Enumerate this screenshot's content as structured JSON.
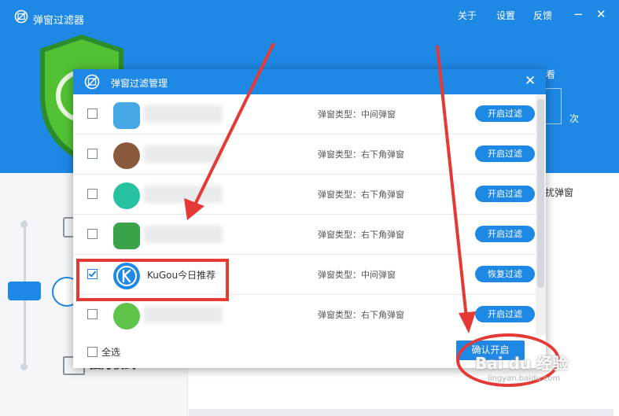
{
  "app": {
    "title": "弹窗过滤器",
    "nav": [
      "关于",
      "设置",
      "反馈"
    ],
    "window_controls": [
      "−",
      "✕"
    ],
    "side_text_1": "看",
    "side_text_2": "次",
    "side_text_3": "扰弹窗",
    "mode_label": "强力模式"
  },
  "dialog": {
    "title": "弹窗过滤管理",
    "close": "✕",
    "rows": [
      {
        "name": "",
        "type": "弹窗类型：中间弹窗",
        "button": "开启过滤",
        "checked": false,
        "thumb_color": "#46a9e6"
      },
      {
        "name": "",
        "type": "弹窗类型：右下角弹窗",
        "button": "开启过滤",
        "checked": false,
        "thumb_color": "#8b5a3c"
      },
      {
        "name": "",
        "type": "弹窗类型：右下角弹窗",
        "button": "开启过滤",
        "checked": false,
        "thumb_color": "#27c2a0"
      },
      {
        "name": "",
        "type": "弹窗类型：右下角弹窗",
        "button": "开启过滤",
        "checked": false,
        "thumb_color": "#3aa34a"
      },
      {
        "name": "KuGou今日推荐",
        "type": "弹窗类型：中间弹窗",
        "button": "恢复过滤",
        "checked": true,
        "thumb_color": "#1e88e5"
      },
      {
        "name": "",
        "type": "弹窗类型：右下角弹窗",
        "button": "开启过滤",
        "checked": false,
        "thumb_color": "#5ec44a"
      }
    ],
    "select_all": "全选",
    "confirm": "确认开启"
  },
  "watermark": {
    "text": "Bai du 经验",
    "url": "jingyan.baidu.com"
  },
  "colors": {
    "primary": "#1e88e5",
    "annotation_red": "#e53935"
  }
}
